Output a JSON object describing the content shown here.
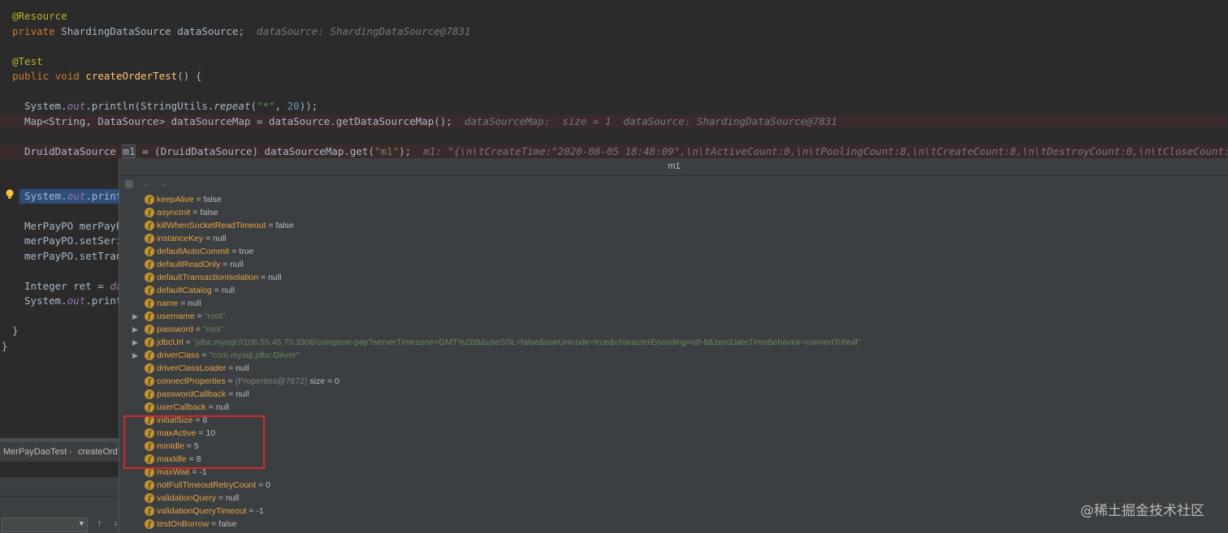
{
  "colors": {
    "editor_bg": "#2b2b2b",
    "popup_bg": "#3c3f41",
    "field_name": "#e8a343",
    "field_icon": "#c4932a",
    "highlight_box": "#d9262a"
  },
  "code": {
    "line1": "@Resource",
    "line2_kw": "private",
    "line2_type": " ShardingDataSource dataSource;",
    "line2_hint": "dataSource: ShardingDataSource@7831",
    "line3": "@Test",
    "line4_kw1": "public",
    "line4_kw2": "void",
    "line4_method": "createOrderTest",
    "line4_rest": "() {",
    "line5_a": "System.",
    "line5_out": "out",
    "line5_b": ".println(StringUtils.",
    "line5_repeat": "repeat",
    "line5_c": "(",
    "line5_str": "\"*\"",
    "line5_d": ", ",
    "line5_num": "20",
    "line5_e": "));",
    "line6_code": "Map<String, DataSource> dataSourceMap = dataSource.getDataSourceMap();",
    "line6_hint": "dataSourceMap:  size = 1  dataSource: ShardingDataSource@7831",
    "line7_a": "DruidDataSource ",
    "line7_var": "m1",
    "line7_b": " = (DruidDataSource) dataSourceMap.get(",
    "line7_str": "\"m1\"",
    "line7_c": ");",
    "line7_hint": "m1: \"{\\n\\tCreateTime:\"2020-08-05 18:48:09\",\\n\\tActiveCount:0,\\n\\tPoolingCount:8,\\n\\tCreateCount:8,\\n\\tDestroyCount:0,\\n\\tCloseCount:10,\\n\\tC",
    "line8_a": "System.",
    "line8_out": "out",
    "line8_b": ".print",
    "line9": "MerPayPO merPayP",
    "line10": "merPayPO.setSeri",
    "line11": "merPayPO.setTran",
    "line12_a": "Integer ret = ",
    "line12_b": "da",
    "line13_a": "System.",
    "line13_out": "out",
    "line13_b": ".print",
    "line14": "}",
    "line15": "}"
  },
  "breadcrumb": {
    "class": "MerPayDaoTest",
    "method": "createOrd"
  },
  "popup": {
    "title": "m1",
    "back_icon": "back-arrow-icon",
    "forward_icon": "forward-arrow-icon",
    "fields": [
      {
        "name": "keepAlive",
        "value": "false",
        "expandable": false
      },
      {
        "name": "asyncInit",
        "value": "false",
        "expandable": false
      },
      {
        "name": "killWhenSocketReadTimeout",
        "value": "false",
        "expandable": false
      },
      {
        "name": "instanceKey",
        "value": "null",
        "expandable": false
      },
      {
        "name": "defaultAutoCommit",
        "value": "true",
        "expandable": false
      },
      {
        "name": "defaultReadOnly",
        "value": "null",
        "expandable": false
      },
      {
        "name": "defaultTransactionIsolation",
        "value": "null",
        "expandable": false
      },
      {
        "name": "defaultCatalog",
        "value": "null",
        "expandable": false
      },
      {
        "name": "name",
        "value": "null",
        "expandable": false
      },
      {
        "name": "username",
        "value": "\"root\"",
        "expandable": true,
        "string": true
      },
      {
        "name": "password",
        "value": "\"root\"",
        "expandable": true,
        "string": true
      },
      {
        "name": "jdbcUrl",
        "value": "\"jdbc:mysql://106.55.45.75:3306/compose-pay?serverTimezone=GMT%2B8&useSSL=false&useUnicode=true&characterEncoding=utf-8&zeroDateTimeBehavior=convertToNull\"",
        "expandable": true,
        "string": true
      },
      {
        "name": "driverClass",
        "value": "\"com.mysql.jdbc.Driver\"",
        "expandable": true,
        "string": true
      },
      {
        "name": "driverClassLoader",
        "value": "null",
        "expandable": false
      },
      {
        "name": "connectProperties",
        "value": "{Properties@7872}",
        "extra": " size = 0",
        "expandable": false,
        "meta": true
      },
      {
        "name": "passwordCallback",
        "value": "null",
        "expandable": false
      },
      {
        "name": "userCallback",
        "value": "null",
        "expandable": false
      },
      {
        "name": "initialSize",
        "value": "8",
        "expandable": false
      },
      {
        "name": "maxActive",
        "value": "10",
        "expandable": false
      },
      {
        "name": "minIdle",
        "value": "5",
        "expandable": false
      },
      {
        "name": "maxIdle",
        "value": "8",
        "expandable": false
      },
      {
        "name": "maxWait",
        "value": "-1",
        "expandable": false
      },
      {
        "name": "notFullTimeoutRetryCount",
        "value": "0",
        "expandable": false
      },
      {
        "name": "validationQuery",
        "value": "null",
        "expandable": false
      },
      {
        "name": "validationQueryTimeout",
        "value": "-1",
        "expandable": false
      },
      {
        "name": "testOnBorrow",
        "value": "false",
        "expandable": false
      }
    ]
  },
  "watermark": "@稀土掘金技术社区"
}
